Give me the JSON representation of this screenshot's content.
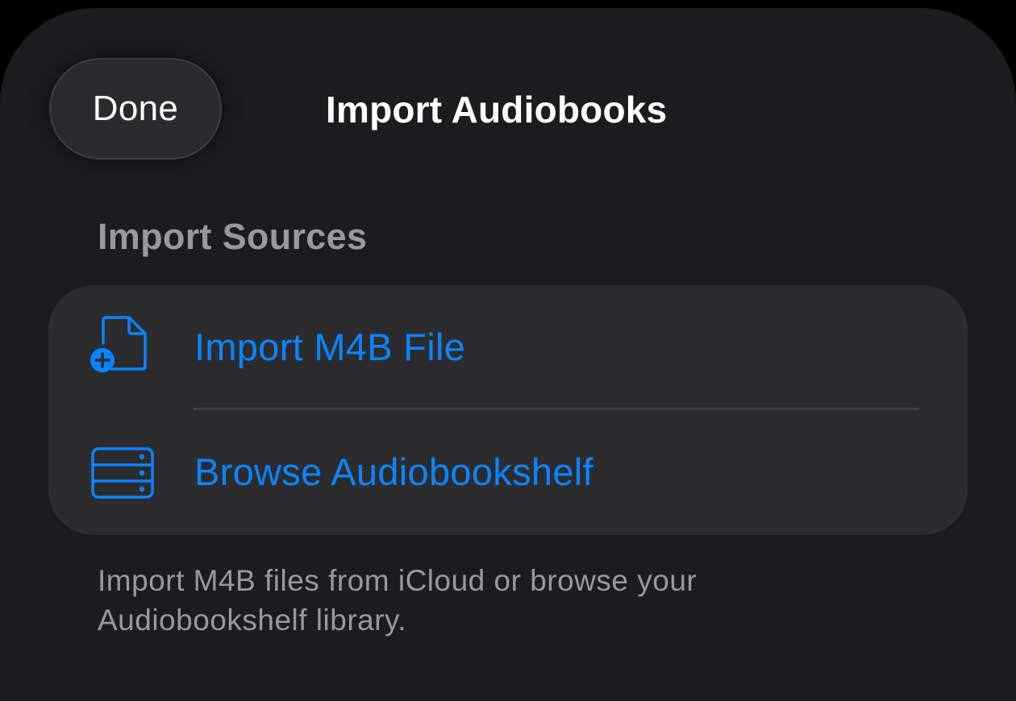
{
  "navigation": {
    "done_label": "Done",
    "title": "Import Audiobooks"
  },
  "section": {
    "header": "Import Sources",
    "items": [
      {
        "label": "Import M4B File",
        "icon": "document-plus-icon"
      },
      {
        "label": "Browse Audiobookshelf",
        "icon": "server-rack-icon"
      }
    ],
    "footer": "Import M4B files from iCloud or browse your Audiobookshelf library."
  },
  "colors": {
    "background": "#000000",
    "sheet": "#1c1c1e",
    "grouped_cell": "#2c2c2e",
    "accent": "#0a84ff",
    "secondary_text": "#98989f",
    "primary_text": "#ffffff"
  }
}
